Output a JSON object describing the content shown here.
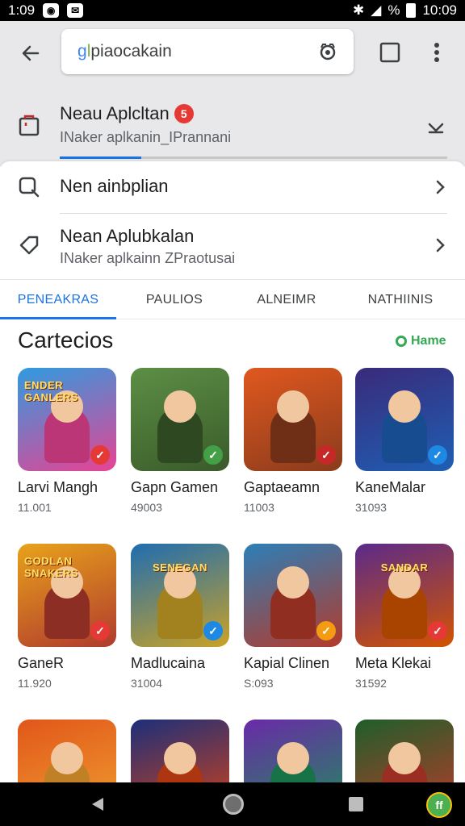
{
  "status_bar": {
    "time_left": "1:09",
    "time_right": "10:09",
    "signal_text": "%"
  },
  "search": {
    "query_g": "g",
    "query_l": "l",
    "query_rest": "piaocakain"
  },
  "app_header": {
    "title": "Neau Aplcltan",
    "badge": "5",
    "subtitle": "INaker aplkanin_IPrannani",
    "progress": 0.21
  },
  "suggestions": [
    {
      "title": "Nen ainbplian",
      "subtitle": ""
    },
    {
      "title": "Nean Aplubkalan",
      "subtitle": "INaker aplkainn ZPraotusai"
    }
  ],
  "tabs": [
    {
      "label": "PENEAKRAS",
      "active": true
    },
    {
      "label": "PAULIOS",
      "active": false
    },
    {
      "label": "ALNEIMR",
      "active": false
    },
    {
      "label": "NATHIINIS",
      "active": false
    }
  ],
  "section": {
    "title": "Cartecios",
    "more_label": "Hame"
  },
  "games": [
    {
      "name": "Larvi Mangh",
      "count": "11.001",
      "banner": "ENDER GANLERS",
      "bg": "#2f9be0",
      "accent": "#e84393",
      "corner": "#e53935"
    },
    {
      "name": "Gapn Gamen",
      "count": "49003",
      "banner": "",
      "bg": "#5c8f45",
      "accent": "#3a5a2a",
      "corner": "#43a047"
    },
    {
      "name": "Gaptaeamn",
      "count": "11003",
      "banner": "",
      "bg": "#e0581f",
      "accent": "#8a3b1c",
      "corner": "#c62828"
    },
    {
      "name": "KaneMalar",
      "count": "31093",
      "banner": "",
      "bg": "#3a2a7a",
      "accent": "#1e5fb4",
      "corner": "#1e88e5"
    },
    {
      "name": "GaneR",
      "count": "11.920",
      "banner": "GODLAN SNAKERS",
      "bg": "#e8a21b",
      "accent": "#b03a2e",
      "corner": "#e53935"
    },
    {
      "name": "Madlucaina",
      "count": "31004",
      "banner": "SENEGAN",
      "bg": "#1f6db0",
      "accent": "#c9a227",
      "corner": "#1e88e5"
    },
    {
      "name": "Kapial Clinen",
      "count": "S:093",
      "banner": "",
      "bg": "#2c7fb8",
      "accent": "#b43a2a",
      "corner": "#f39c12"
    },
    {
      "name": "Meta Klekai",
      "count": "31592",
      "banner": "SANDAR",
      "bg": "#5b2a8a",
      "accent": "#d35400",
      "corner": "#e53935"
    },
    {
      "name": "",
      "count": "",
      "banner": "",
      "bg": "#e1561a",
      "accent": "#f0a030",
      "corner": ""
    },
    {
      "name": "",
      "count": "",
      "banner": "",
      "bg": "#1c2f7a",
      "accent": "#d84315",
      "corner": ""
    },
    {
      "name": "",
      "count": "",
      "banner": "",
      "bg": "#6a2aa8",
      "accent": "#1e8f5a",
      "corner": ""
    },
    {
      "name": "",
      "count": "",
      "banner": "",
      "bg": "#1f5e2a",
      "accent": "#c0392b",
      "corner": ""
    }
  ],
  "nav": {
    "fab_label": "ff"
  }
}
